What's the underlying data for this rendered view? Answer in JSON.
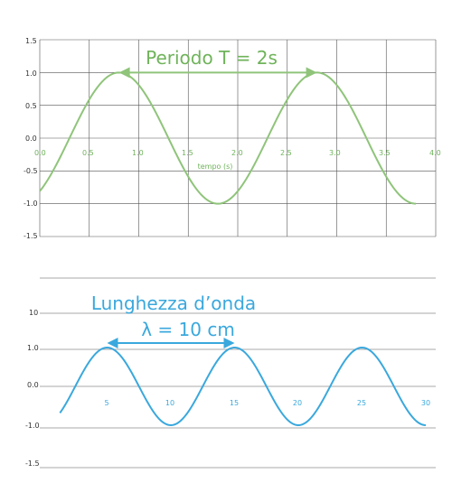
{
  "colors": {
    "green": "#8fc47a",
    "green_text": "#6fb35a",
    "blue": "#3aa8dd",
    "grid": "#555555",
    "tick_text": "#333333"
  },
  "chart_data": [
    {
      "type": "line",
      "title": "",
      "xlabel": "tempo (s)",
      "ylabel": "",
      "xlim": [
        0,
        4.0
      ],
      "ylim": [
        -1.5,
        1.5
      ],
      "grid": true,
      "x_ticks": [
        "0.0",
        "0.5",
        "1.0",
        "1.5",
        "2.0",
        "2.5",
        "3.0",
        "3.5",
        "4.0"
      ],
      "y_ticks": [
        "1.5",
        "1.0",
        "0.5",
        "0.0",
        "-0.5",
        "-1.0",
        "-1.5"
      ],
      "annotation": "Periodo T = 2s",
      "series": [
        {
          "function": "sine",
          "amplitude": 1.0,
          "period": 2.0,
          "x_start": 0.0,
          "x_end": 3.8,
          "y_at_start": -0.8,
          "peaks_x": [
            0.8,
            2.8
          ],
          "troughs_x": [
            1.8,
            3.8
          ]
        }
      ],
      "arrow": {
        "from_x": 0.8,
        "to_x": 2.8,
        "y": 1.0
      }
    },
    {
      "type": "line",
      "title": "",
      "xlabel": "",
      "ylabel": "",
      "xlim": [
        0,
        30
      ],
      "ylim": [
        -1.5,
        1.5
      ],
      "grid": false,
      "x_ticks": [
        "5",
        "10",
        "15",
        "20",
        "25",
        "30"
      ],
      "y_ticks": [
        "10",
        "1.0",
        "0.0",
        "-1.0",
        "-1.5"
      ],
      "annotation": [
        "Lunghezza d’onda",
        "λ = 10 cm"
      ],
      "series": [
        {
          "function": "sine",
          "amplitude": 1.0,
          "wavelength": 10,
          "x_start": 0.0,
          "x_end": 30.0,
          "y_at_start": -0.8,
          "peaks_x": [
            5,
            15,
            25
          ],
          "troughs_x": [
            10,
            20,
            30
          ]
        }
      ],
      "arrow": {
        "from_x": 5,
        "to_x": 15,
        "y": 1.0
      }
    }
  ]
}
